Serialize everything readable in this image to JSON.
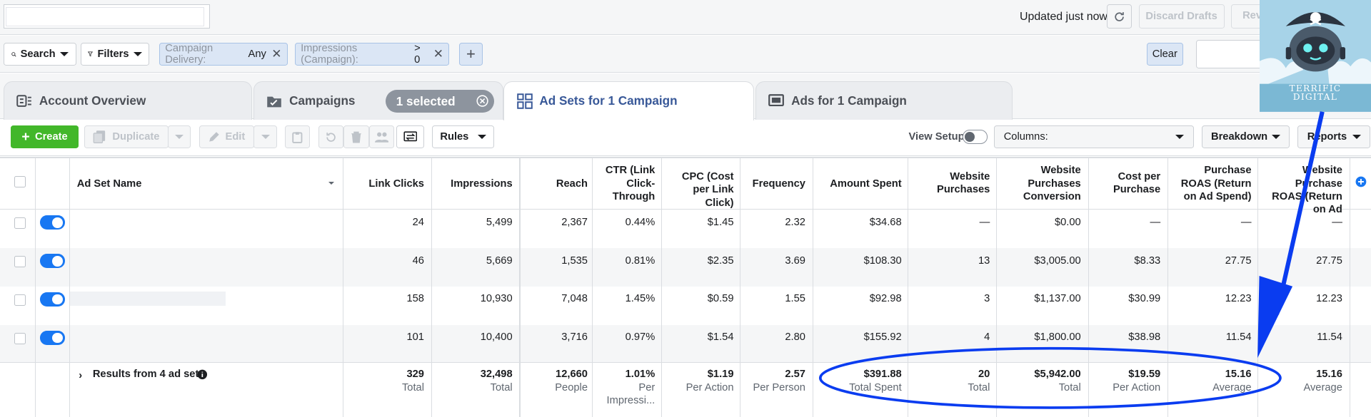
{
  "topbar": {
    "updated_text": "Updated just now",
    "discard_label": "Discard Drafts",
    "review_label": "Revi"
  },
  "filters": {
    "search_label": "Search",
    "filters_label": "Filters",
    "chip1_key": "Campaign Delivery:",
    "chip1_value": "Any",
    "chip2_key": "Impressions (Campaign):",
    "chip2_value": "> 0",
    "clear_label": "Clear"
  },
  "tabs": [
    {
      "label": "Account Overview",
      "icon": "account-overview-icon"
    },
    {
      "label": "Campaigns",
      "icon": "folder-icon",
      "selected_pill": "1 selected"
    },
    {
      "label": "Ad Sets for 1 Campaign",
      "icon": "grid-icon"
    },
    {
      "label": "Ads for 1 Campaign",
      "icon": "ad-icon"
    }
  ],
  "toolbar": {
    "create_label": "Create",
    "duplicate_label": "Duplicate",
    "edit_label": "Edit",
    "rules_label": "Rules",
    "view_setup_label": "View Setup",
    "columns_label": "Columns:",
    "breakdown_label": "Breakdown",
    "reports_label": "Reports"
  },
  "table": {
    "headers": {
      "name": "Ad Set Name",
      "link_clicks": "Link Clicks",
      "impressions": "Impressions",
      "reach": "Reach",
      "ctr": "CTR (Link Click-Through",
      "cpc": "CPC (Cost per Link Click)",
      "frequency": "Frequency",
      "amount_spent": "Amount Spent",
      "website_purchases": "Website Purchases",
      "conversion": "Website Purchases Conversion",
      "cost_per_purchase": "Cost per Purchase",
      "roas": "Purchase ROAS (Return on Ad Spend)",
      "website_roas": "Website Purchase ROAS (Return on Ad"
    },
    "rows": [
      {
        "link_clicks": "24",
        "impressions": "5,499",
        "reach": "2,367",
        "ctr": "0.44%",
        "cpc": "$1.45",
        "frequency": "2.32",
        "amount_spent": "$34.68",
        "website_purchases": "—",
        "conversion": "$0.00",
        "cost_per_purchase": "—",
        "roas": "—",
        "website_roas": "—"
      },
      {
        "link_clicks": "46",
        "impressions": "5,669",
        "reach": "1,535",
        "ctr": "0.81%",
        "cpc": "$2.35",
        "frequency": "3.69",
        "amount_spent": "$108.30",
        "website_purchases": "13",
        "conversion": "$3,005.00",
        "cost_per_purchase": "$8.33",
        "roas": "27.75",
        "website_roas": "27.75"
      },
      {
        "link_clicks": "158",
        "impressions": "10,930",
        "reach": "7,048",
        "ctr": "1.45%",
        "cpc": "$0.59",
        "frequency": "1.55",
        "amount_spent": "$92.98",
        "website_purchases": "3",
        "conversion": "$1,137.00",
        "cost_per_purchase": "$30.99",
        "roas": "12.23",
        "website_roas": "12.23"
      },
      {
        "link_clicks": "101",
        "impressions": "10,400",
        "reach": "3,716",
        "ctr": "0.97%",
        "cpc": "$1.54",
        "frequency": "2.80",
        "amount_spent": "$155.92",
        "website_purchases": "4",
        "conversion": "$1,800.00",
        "cost_per_purchase": "$38.98",
        "roas": "11.54",
        "website_roas": "11.54"
      }
    ],
    "totals": {
      "label": "Results from 4 ad sets",
      "link_clicks": "329",
      "link_clicks_sub": "Total",
      "impressions": "32,498",
      "impressions_sub": "Total",
      "reach": "12,660",
      "reach_sub": "People",
      "ctr": "1.01%",
      "ctr_sub": "Per Impressi...",
      "cpc": "$1.19",
      "cpc_sub": "Per Action",
      "frequency": "2.57",
      "frequency_sub": "Per Person",
      "amount_spent": "$391.88",
      "amount_spent_sub": "Total Spent",
      "website_purchases": "20",
      "website_purchases_sub": "Total",
      "conversion": "$5,942.00",
      "conversion_sub": "Total",
      "cost_per_purchase": "$19.59",
      "cost_per_purchase_sub": "Per Action",
      "roas": "15.16",
      "roas_sub": "Average",
      "website_roas": "15.16",
      "website_roas_sub": "Average"
    }
  },
  "badge": {
    "line1": "TERRIFIC",
    "line2": "DIGITAL"
  },
  "colors": {
    "accent": "#1877f2",
    "create_green": "#42b72a",
    "annotation_blue": "#0a3cf0",
    "active_tab_text": "#385898"
  }
}
